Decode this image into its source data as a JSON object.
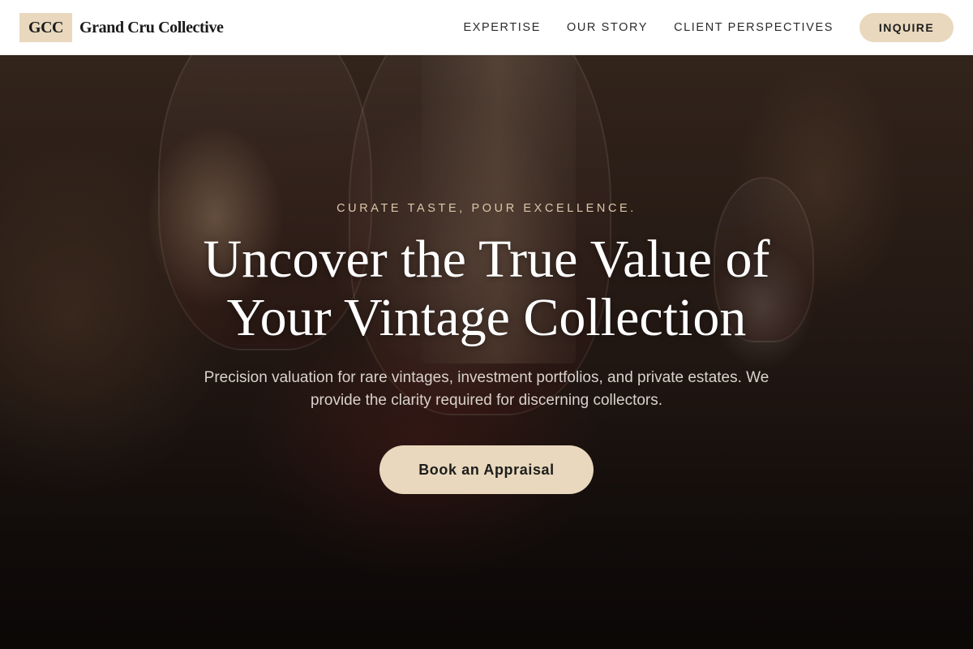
{
  "header": {
    "logo_mark": "GCC",
    "logo_text": "Grand Cru Collective",
    "nav": [
      {
        "label": "EXPERTISE"
      },
      {
        "label": "OUR STORY"
      },
      {
        "label": "CLIENT PERSPECTIVES"
      }
    ],
    "inquire_label": "INQUIRE"
  },
  "hero": {
    "eyebrow": "CURATE TASTE, POUR EXCELLENCE.",
    "title_line1": "Uncover the True Value of",
    "title_line2": "Your Vintage Collection",
    "subtitle_line1": "Precision valuation for rare vintages, investment portfolios, and private estates. We",
    "subtitle_line2": "provide the clarity required for discerning collectors.",
    "cta_label": "Book an Appraisal",
    "image_icon": "wine-glasses-photo"
  },
  "colors": {
    "accent": "#e9d8bd",
    "eyebrow": "#dcc7a8",
    "header_bg": "#ffffff",
    "text_dark": "#1a1a1a"
  }
}
